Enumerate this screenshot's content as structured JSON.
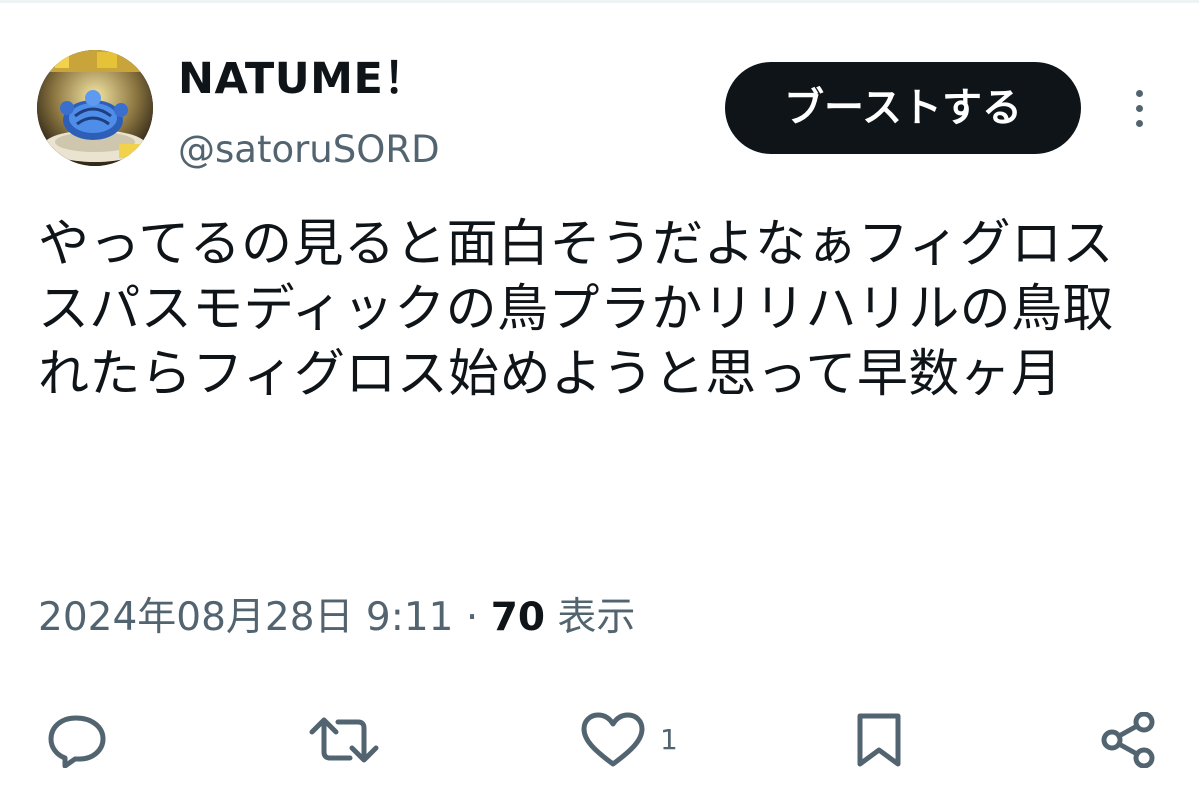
{
  "tweet": {
    "author": {
      "display_name": "NATUME！",
      "handle": "@satoruSORD",
      "avatar_icon": "avatar-image"
    },
    "boost_label": "ブーストする",
    "more_icon": "more-vertical-icon",
    "text": "やってるの見ると面白そうだよなぁフィグロス\nスパスモディックの鳥プラかリリハリルの鳥取れたらフィグロス始めようと思って早数ヶ月",
    "timestamp": "2024年08月28日 9:11",
    "separator": "·",
    "views_count": "70",
    "views_label": "表示"
  },
  "actions": {
    "reply_icon": "reply-icon",
    "retweet_icon": "retweet-icon",
    "like_icon": "heart-icon",
    "like_count": "1",
    "bookmark_icon": "bookmark-icon",
    "share_icon": "share-icon"
  },
  "colors": {
    "text_primary": "#0f1419",
    "text_secondary": "#536471",
    "button_bg": "#0f1419",
    "button_text": "#ffffff"
  }
}
